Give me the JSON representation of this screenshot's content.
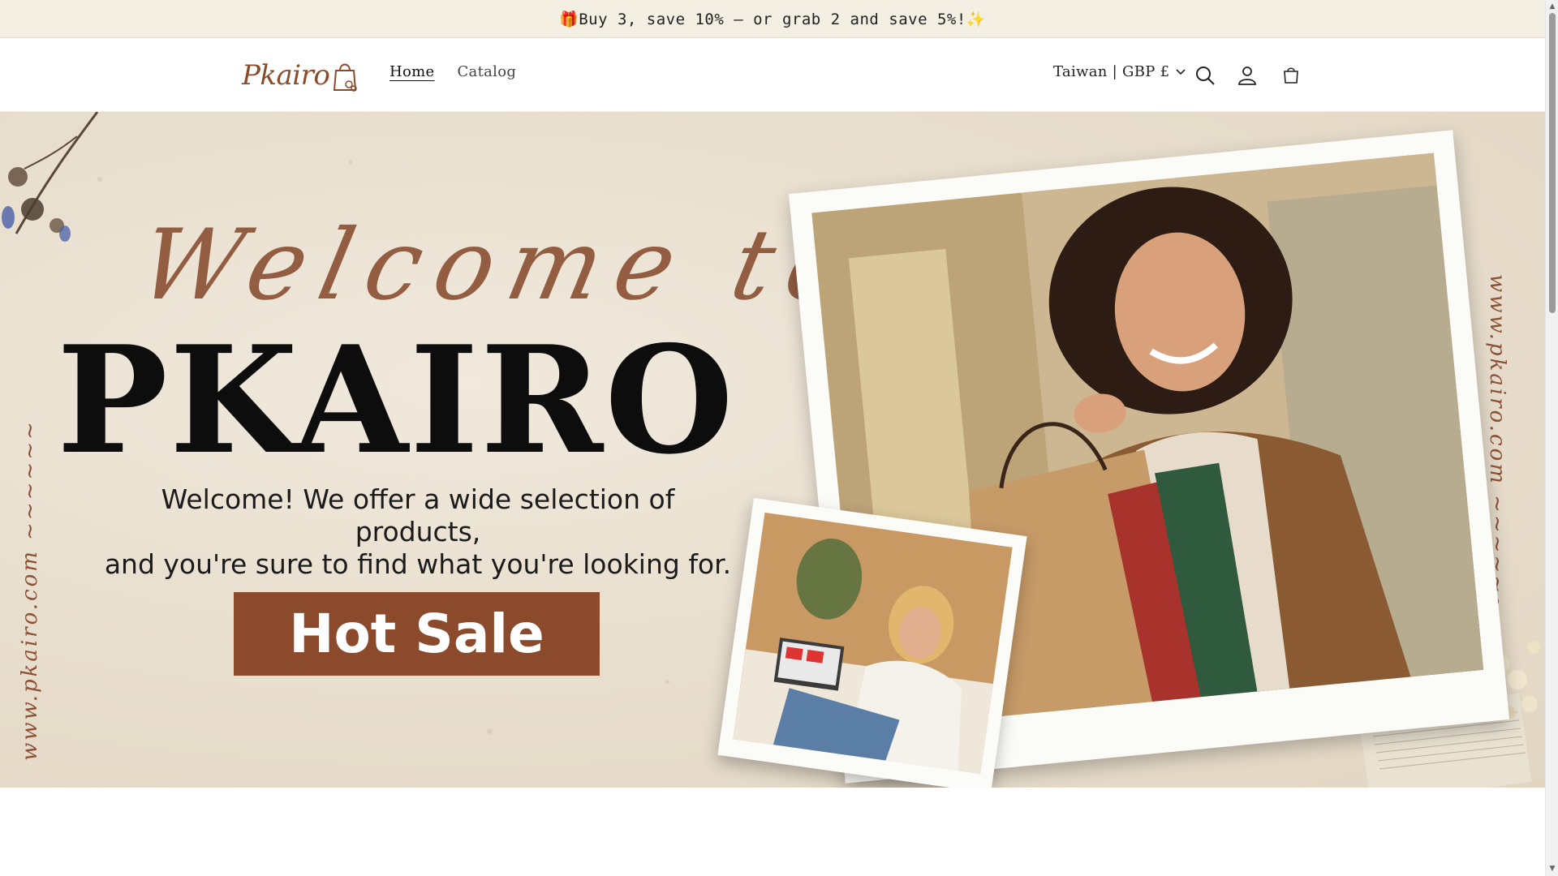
{
  "announcement": {
    "text": "🎁Buy 3, save 10% – or grab 2 and save 5%!✨"
  },
  "header": {
    "logo_text": "Pkairo",
    "nav": [
      {
        "label": "Home",
        "active": true
      },
      {
        "label": "Catalog",
        "active": false
      }
    ],
    "country_selector": "Taiwan | GBP £",
    "icons": [
      "search-icon",
      "account-icon",
      "cart-icon"
    ]
  },
  "hero": {
    "script_heading": "Welcome to",
    "brand_heading": "PKAIRO",
    "tagline_line1": "Welcome! We offer a wide selection of products,",
    "tagline_line2": "and you're sure to find what you're looking for.",
    "cta_label": "Hot Sale",
    "side_url_left": "www.pkairo.com ~~~~~~",
    "side_url_right": "www.pkairo.com ~~~~~~"
  },
  "colors": {
    "accent_brown": "#8b4a2b",
    "announcement_bg": "#f3efe3",
    "hero_bg": "#e9dfcf"
  }
}
